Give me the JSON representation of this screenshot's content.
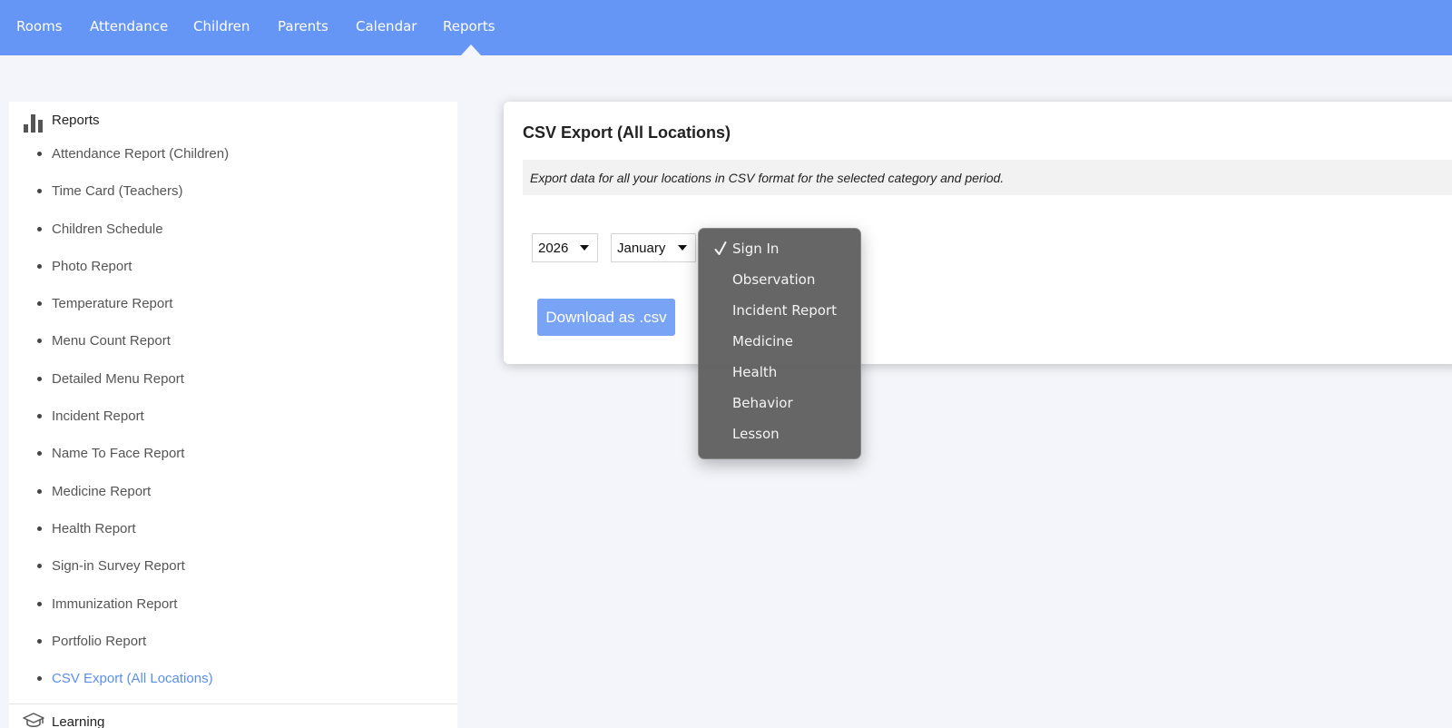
{
  "topnav": {
    "items": [
      {
        "label": "Rooms"
      },
      {
        "label": "Attendance"
      },
      {
        "label": "Children"
      },
      {
        "label": "Parents"
      },
      {
        "label": "Calendar"
      },
      {
        "label": "Reports",
        "active": true
      }
    ]
  },
  "sidebar": {
    "section_icon": "bar-chart-icon",
    "section_title": "Reports",
    "items": [
      {
        "label": "Attendance Report (Children)"
      },
      {
        "label": "Time Card (Teachers)"
      },
      {
        "label": "Children Schedule"
      },
      {
        "label": "Photo Report"
      },
      {
        "label": "Temperature Report"
      },
      {
        "label": "Menu Count Report"
      },
      {
        "label": "Detailed Menu Report"
      },
      {
        "label": "Incident Report"
      },
      {
        "label": "Name To Face Report"
      },
      {
        "label": "Medicine Report"
      },
      {
        "label": "Health Report"
      },
      {
        "label": "Sign-in Survey Report"
      },
      {
        "label": "Immunization Report"
      },
      {
        "label": "Portfolio Report"
      },
      {
        "label": "CSV Export (All Locations)",
        "active": true
      }
    ],
    "next_section_icon": "graduation-cap-icon",
    "next_section_title": "Learning"
  },
  "card": {
    "title": "CSV Export (All Locations)",
    "description": "Export data for all your locations in CSV format for the selected category and period.",
    "year_select": {
      "value": "2026"
    },
    "month_select": {
      "value": "January"
    },
    "download_label": "Download as .csv"
  },
  "category_dropdown": {
    "selected": "Sign In",
    "options": [
      "Sign In",
      "Observation",
      "Incident Report",
      "Medicine",
      "Health",
      "Behavior",
      "Lesson"
    ]
  },
  "colors": {
    "nav_background": "#6595f5",
    "accent": "#5b8fef",
    "button": "#79a3f4",
    "page_background": "#f4f5fa",
    "dropdown_background": "#606060"
  }
}
